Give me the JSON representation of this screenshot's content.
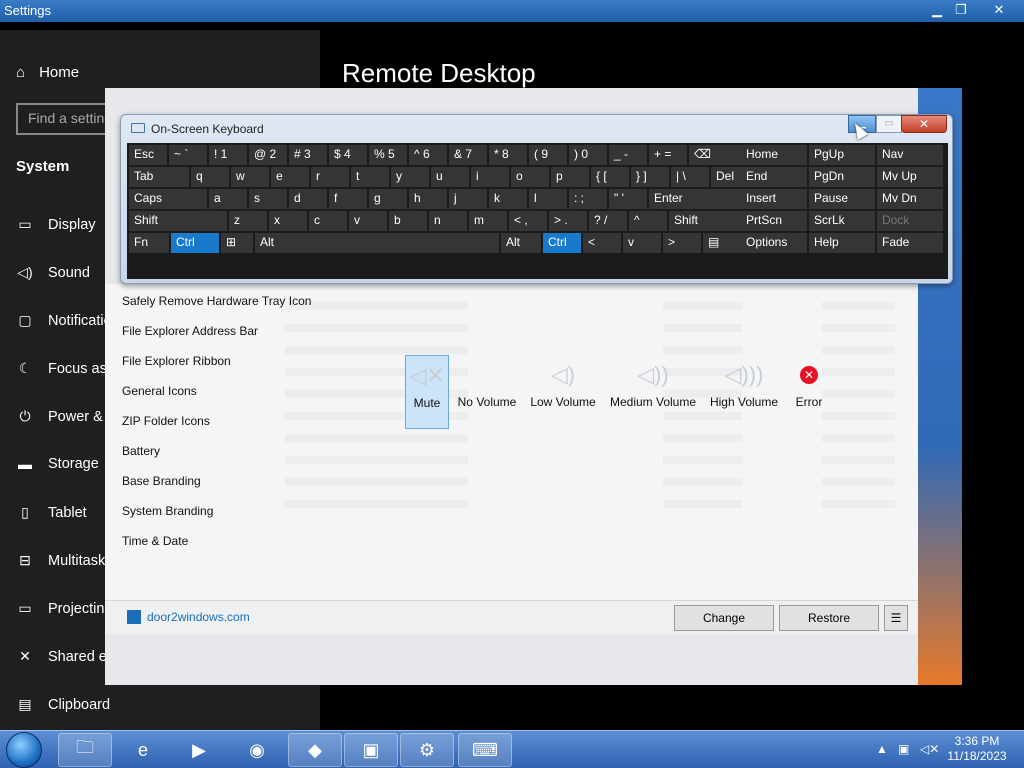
{
  "settings": {
    "window_title": "Settings",
    "home": "Home",
    "search_placeholder": "Find a setting",
    "section": "System",
    "nav": [
      "Display",
      "Sound",
      "Notifications",
      "Focus assist",
      "Power & sleep",
      "Storage",
      "Tablet",
      "Multitasking",
      "Projecting",
      "Shared experiences",
      "Clipboard"
    ],
    "page_title": "Remote Desktop"
  },
  "osk": {
    "title": "On-Screen Keyboard",
    "rows": [
      [
        "Esc",
        "~ `",
        "! 1",
        "@ 2",
        "# 3",
        "$ 4",
        "% 5",
        "^ 6",
        "& 7",
        "* 8",
        "( 9",
        ") 0",
        "_ -",
        "+ =",
        "⌫"
      ],
      [
        "Tab",
        "q",
        "w",
        "e",
        "r",
        "t",
        "y",
        "u",
        "i",
        "o",
        "p",
        "{ [",
        "} ]",
        "| \\",
        "Del"
      ],
      [
        "Caps",
        "a",
        "s",
        "d",
        "f",
        "g",
        "h",
        "j",
        "k",
        "l",
        ": ;",
        "\" '",
        "Enter"
      ],
      [
        "Shift",
        "z",
        "x",
        "c",
        "v",
        "b",
        "n",
        "m",
        "< ,",
        "> .",
        "? /",
        "^",
        "Shift"
      ],
      [
        "Fn",
        "Ctrl",
        "⊞",
        "Alt",
        "Alt",
        "Ctrl",
        "<",
        "v",
        ">",
        "▤"
      ]
    ],
    "nav_keys": [
      [
        "Home",
        "PgUp",
        "Nav"
      ],
      [
        "End",
        "PgDn",
        "Mv Up"
      ],
      [
        "Insert",
        "Pause",
        "Mv Dn"
      ],
      [
        "PrtScn",
        "ScrLk",
        "Dock"
      ],
      [
        "Options",
        "Help",
        "Fade"
      ]
    ]
  },
  "app": {
    "list": [
      "Safely Remove Hardware Tray Icon",
      "File Explorer Address Bar",
      "File Explorer Ribbon",
      "General Icons",
      "ZIP Folder Icons",
      "Battery",
      "Base Branding",
      "System Branding",
      "Time & Date"
    ],
    "volume_options": [
      "Mute",
      "No Volume",
      "Low Volume",
      "Medium Volume",
      "High Volume",
      "Error"
    ],
    "brand": "door2windows.com",
    "change": "Change",
    "restore": "Restore"
  },
  "taskbar": {
    "time": "3:36 PM",
    "date": "11/18/2023"
  }
}
